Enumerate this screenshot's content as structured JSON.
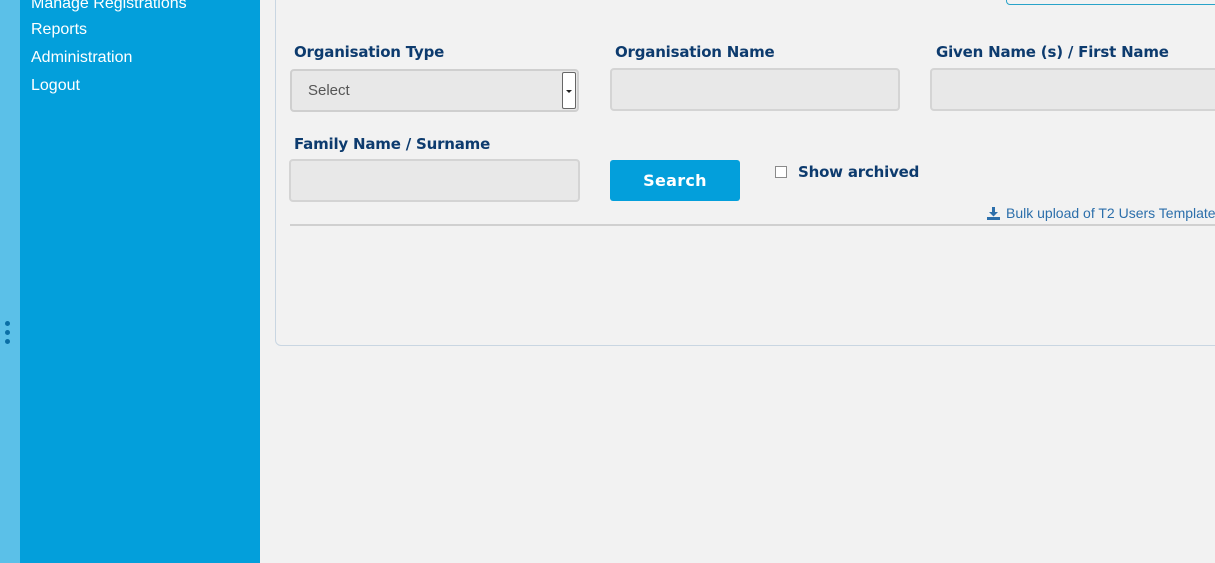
{
  "sidebar": {
    "items": [
      {
        "label": "Manage Registrations"
      },
      {
        "label": "Reports"
      },
      {
        "label": "Administration"
      },
      {
        "label": "Logout"
      }
    ]
  },
  "form": {
    "org_type_label": "Organisation Type",
    "org_type_value": "Select",
    "org_name_label": "Organisation Name",
    "org_name_value": "",
    "given_name_label": "Given Name (s) / First Name",
    "given_name_value": "",
    "family_name_label": "Family Name / Surname",
    "family_name_value": "",
    "search_label": "Search",
    "show_archived_label": "Show archived",
    "show_archived_checked": false,
    "bulk_upload_label": "Bulk upload of T2 Users Template"
  },
  "icons": {
    "select_arrow": "chevron-down-icon",
    "bulk_upload": "download-icon",
    "drag_handle": "vertical-dots-icon"
  },
  "colors": {
    "sidebar_bg": "#039fdb",
    "edge_strip": "#5bc0e8",
    "label_text": "#0d3b6e",
    "link_text": "#2c6fab",
    "button_bg": "#039fdb"
  }
}
